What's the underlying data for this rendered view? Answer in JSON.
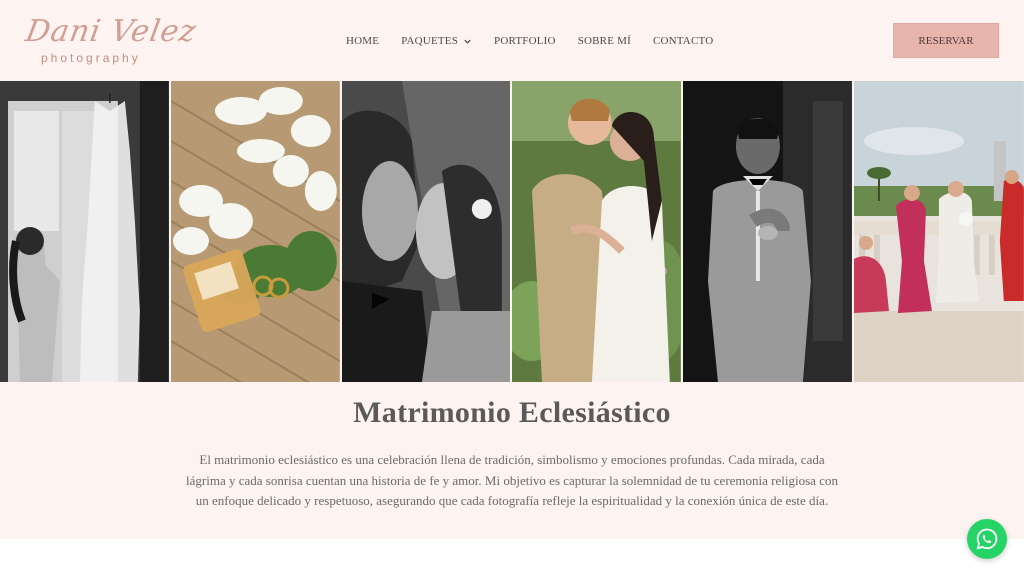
{
  "brand": {
    "script": "Dani Velez",
    "sub": "photography",
    "color": "#d29d92"
  },
  "nav": {
    "items": [
      {
        "label": "HOME"
      },
      {
        "label": "PAQUETES"
      },
      {
        "label": "PORTFOLIO"
      },
      {
        "label": "SOBRE MÍ"
      },
      {
        "label": "CONTACTO"
      }
    ]
  },
  "header": {
    "reserve_label": "RESERVAR",
    "bg": "#fdf3f0",
    "button_color": "#e8b5ac"
  },
  "gallery": {
    "photos": [
      {
        "icon": "bride-dress-window-photo"
      },
      {
        "icon": "flowers-rings-perfume-photo"
      },
      {
        "icon": "couple-kiss-veil-photo"
      },
      {
        "icon": "couple-embrace-garden-photo"
      },
      {
        "icon": "groom-cufflinks-photo"
      },
      {
        "icon": "bride-bridesmaids-photo"
      }
    ]
  },
  "section": {
    "title": "Matrimonio Eclesiástico",
    "description": "El matrimonio eclesiástico es una celebración llena de tradición, simbolismo y emociones profundas. Cada mirada, cada lágrima y cada sonrisa cuentan una historia de fe y amor. Mi objetivo es capturar la solemnidad de tu ceremonia religiosa con un enfoque delicado y respetuoso, asegurando que cada fotografía refleje la espiritualidad y la conexión única de este día."
  },
  "floating": {
    "icon": "whatsapp-icon",
    "color": "#25d366"
  }
}
